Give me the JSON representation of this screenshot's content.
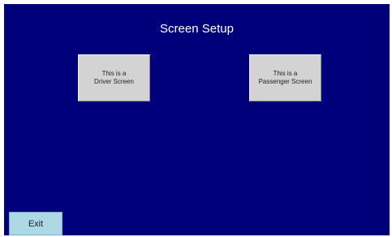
{
  "page": {
    "title": "Screen Setup"
  },
  "buttons": {
    "driver": {
      "line1": "This is a",
      "line2": "Driver Screen"
    },
    "passenger": {
      "line1": "This is a",
      "line2": "Passenger Screen"
    },
    "exit_label": "Exit"
  },
  "colors": {
    "background": "#00007a",
    "choice_button": "#d3d3d3",
    "exit_button": "#add8e6",
    "title_text": "#ffffff"
  }
}
